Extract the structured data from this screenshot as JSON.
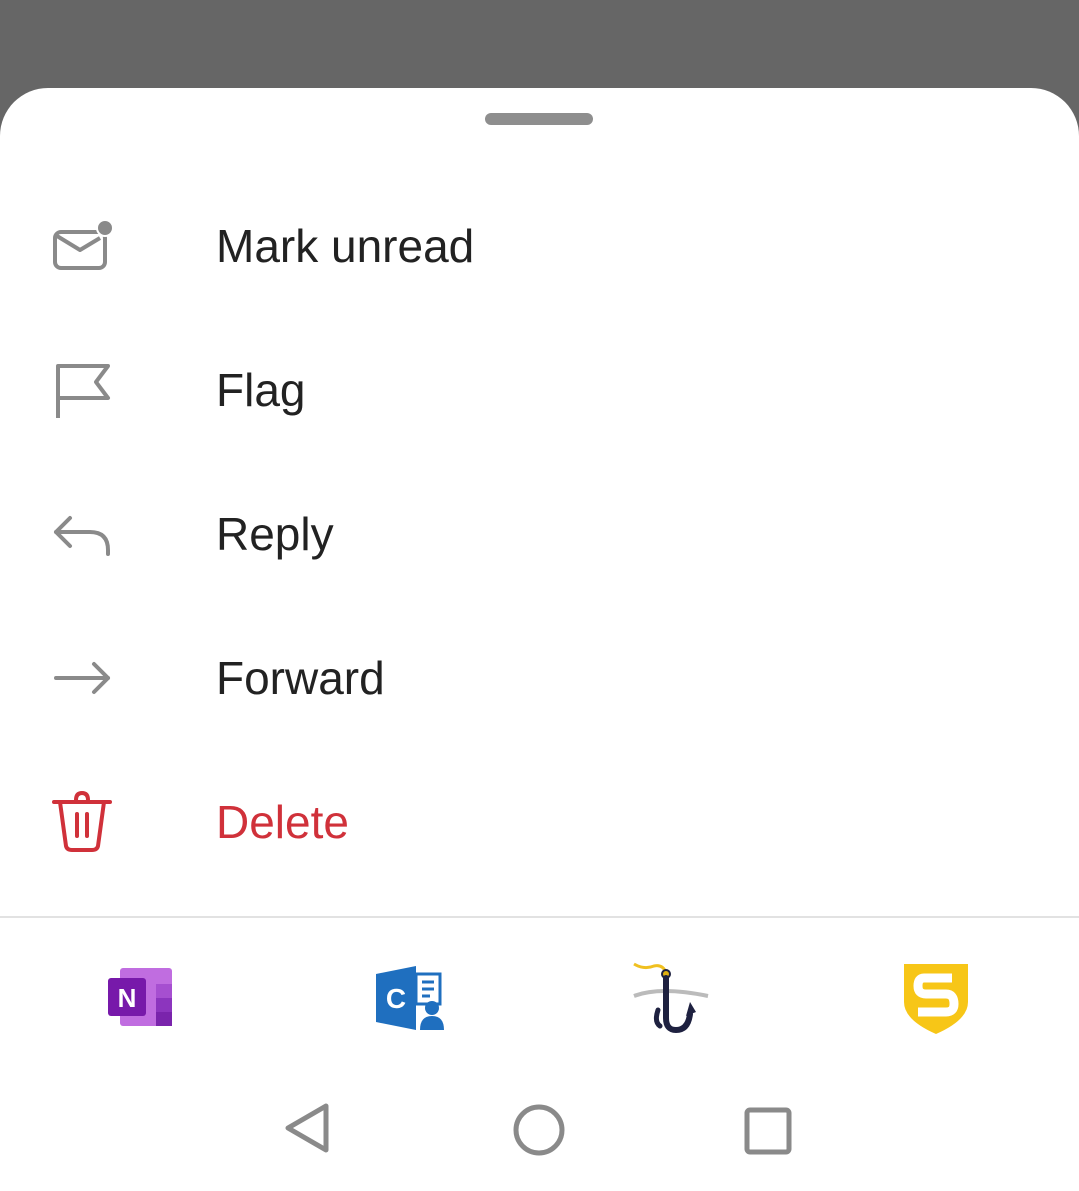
{
  "sheet": {
    "menu": [
      {
        "id": "mark-unread",
        "label": "Mark unread",
        "icon": "mail-unread-icon"
      },
      {
        "id": "flag",
        "label": "Flag",
        "icon": "flag-icon"
      },
      {
        "id": "reply",
        "label": "Reply",
        "icon": "reply-icon"
      },
      {
        "id": "forward",
        "label": "Forward",
        "icon": "forward-icon"
      },
      {
        "id": "delete",
        "label": "Delete",
        "icon": "trash-icon",
        "color": "#d0313a"
      }
    ],
    "addins": [
      {
        "name": "OneNote",
        "icon": "onenote-icon"
      },
      {
        "name": "Contacts",
        "icon": "contacts-addin-icon"
      },
      {
        "name": "Phishing report",
        "icon": "fishhook-icon"
      },
      {
        "name": "Security",
        "icon": "shield-s-icon"
      }
    ]
  },
  "navbar": {
    "back": "back-icon",
    "home": "home-icon",
    "recents": "recents-icon"
  },
  "colors": {
    "scrim": "#666666",
    "text": "#222222",
    "icon": "#8a8a8a",
    "danger": "#d0313a"
  }
}
